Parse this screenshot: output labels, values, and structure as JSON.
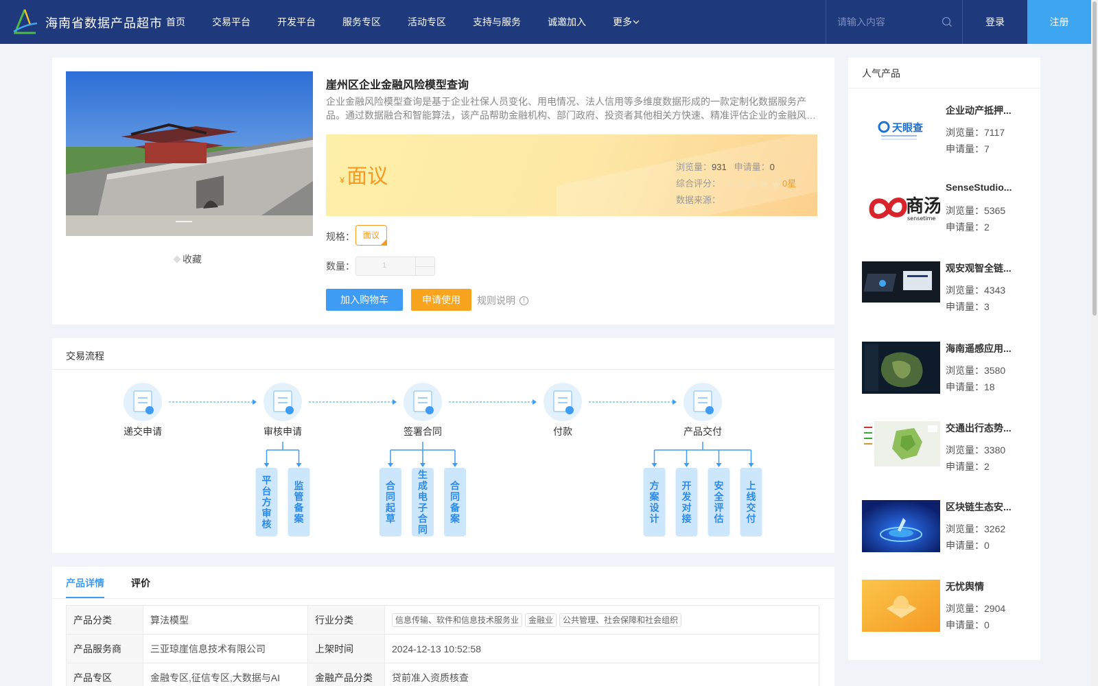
{
  "header": {
    "brand": "海南省数据产品超市",
    "nav": [
      "首页",
      "交易平台",
      "开发平台",
      "服务专区",
      "活动专区",
      "支持与服务",
      "诚邀加入",
      "更多"
    ],
    "search_placeholder": "请输入内容",
    "login": "登录",
    "register": "注册"
  },
  "product": {
    "title": "崖州区企业金融风险模型查询",
    "description": "企业金融风险模型查询是基于企业社保人员变化、用电情况、法人信用等多维度数据形成的一款定制化数据服务产品。通过数据融合和智能算法，该产品帮助金融机构、部门政府、投资者其他相关方快速、精准评估企业的金融风险。",
    "currency": "¥",
    "price": "面议",
    "views_label": "浏览量：",
    "views": "931",
    "apply_label": "申请量：",
    "apply": "0",
    "rating_label": "综合评分：",
    "rating": 0,
    "rating_text": "0星",
    "source_label": "数据来源：",
    "favorite": "收藏",
    "spec_label": "规格：",
    "spec_value": "面议",
    "qty_label": "数量：",
    "qty_value": "1",
    "add_cart": "加入购物车",
    "apply_use": "申请使用",
    "rules": "规则说明"
  },
  "flow": {
    "title": "交易流程",
    "steps": [
      {
        "label": "递交申请",
        "subs": []
      },
      {
        "label": "审核申请",
        "subs": [
          "平台方审核",
          "监管备案"
        ]
      },
      {
        "label": "签署合同",
        "subs": [
          "合同起草",
          "生成电子合同",
          "合同备案"
        ]
      },
      {
        "label": "付款",
        "subs": []
      },
      {
        "label": "产品交付",
        "subs": [
          "方案设计",
          "开发对接",
          "安全评估",
          "上线交付"
        ]
      }
    ]
  },
  "details": {
    "tabs": [
      "产品详情",
      "评价"
    ],
    "rows": [
      {
        "k1": "产品分类",
        "v1": "算法模型",
        "k2": "行业分类",
        "tags": [
          "信息传输、软件和信息技术服务业",
          "金融业",
          "公共管理、社会保障和社会组织"
        ]
      },
      {
        "k1": "产品服务商",
        "v1": "三亚琼崖信息技术有限公司",
        "k2": "上架时间",
        "v2": "2024-12-13 10:52:58"
      },
      {
        "k1": "产品专区",
        "v1": "金融专区,征信专区,大数据与AI",
        "k2": "金融产品分类",
        "v2": "贷前准入资质核查"
      }
    ]
  },
  "sidebar": {
    "title": "人气产品",
    "views_label": "浏览量：",
    "apply_label": "申请量：",
    "items": [
      {
        "name": "企业动产抵押...",
        "views": "7117",
        "apply": "7",
        "logo_text": "天眼查"
      },
      {
        "name": "SenseStudio...",
        "views": "5365",
        "apply": "2",
        "logo_text": "商汤",
        "logo_sub": "sensetime"
      },
      {
        "name": "观安观智全链...",
        "views": "4343",
        "apply": "3"
      },
      {
        "name": "海南遥感应用...",
        "views": "3580",
        "apply": "18"
      },
      {
        "name": "交通出行态势...",
        "views": "3380",
        "apply": "2"
      },
      {
        "name": "区块链生态安...",
        "views": "3262",
        "apply": "0"
      },
      {
        "name": "无忧舆情",
        "views": "2904",
        "apply": "0"
      }
    ]
  },
  "colors": {
    "header_bg": "#1e3a7d",
    "accent_blue": "#3e9cf5",
    "accent_orange": "#f59a23"
  }
}
